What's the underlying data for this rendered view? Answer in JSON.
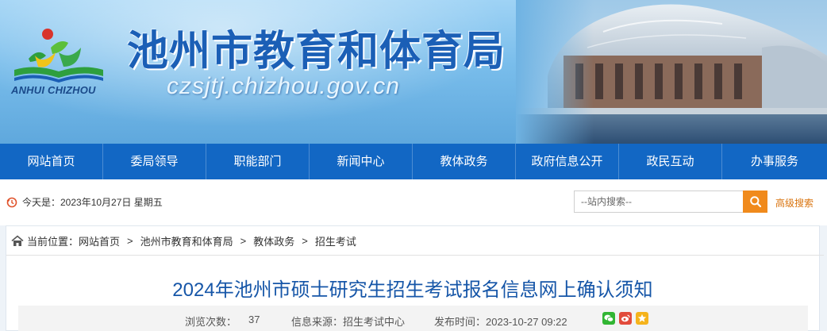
{
  "header": {
    "site_title": "池州市教育和体育局",
    "logo_text": "ANHUI CHIZHOU",
    "domain": "czsjtj.chizhou.gov.cn"
  },
  "nav": {
    "items": [
      "网站首页",
      "委局领导",
      "职能部门",
      "新闻中心",
      "教体政务",
      "政府信息公开",
      "政民互动",
      "办事服务"
    ]
  },
  "infobar": {
    "date_text": "今天是：2023年10月27日 星期五",
    "search_placeholder": "--站内搜索--",
    "advanced_search": "高级搜索"
  },
  "breadcrumb": {
    "label": "当前位置：",
    "items": [
      "网站首页",
      "池州市教育和体育局",
      "教体政务",
      "招生考试"
    ]
  },
  "article": {
    "title": "2024年池州市硕士研究生招生考试报名信息网上确认须知",
    "views_label": "浏览次数：",
    "views": "37",
    "source": "信息来源：招生考试中心",
    "published": "发布时间：2023-10-27 09:22"
  },
  "colors": {
    "nav_bg": "#1267c4",
    "title_blue": "#1656a8",
    "accent_orange": "#f08a1c",
    "wechat_green": "#31b533",
    "weibo_red": "#e24b3b",
    "qzone_yellow": "#f5b31c"
  },
  "icons": [
    "clock-icon",
    "search-icon",
    "home-icon",
    "wechat-icon",
    "weibo-icon",
    "qzone-icon"
  ]
}
